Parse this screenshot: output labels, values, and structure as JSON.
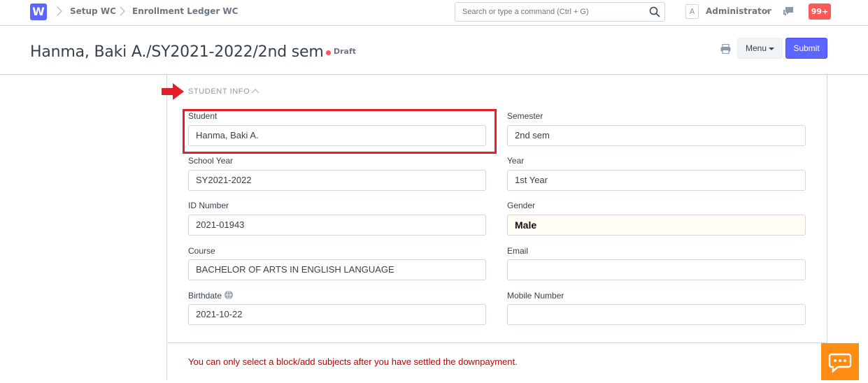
{
  "navbar": {
    "logo": "W",
    "breadcrumbs": [
      "Setup WC",
      "Enrollment Ledger WC"
    ],
    "search_placeholder": "Search or type a command (Ctrl + G)",
    "avatar_letter": "A",
    "user_name": "Administrator",
    "notification_count": "99+"
  },
  "page": {
    "title": "Hanma, Baki A./SY2021-2022/2nd sem",
    "status": "Draft",
    "status_color": "#ff5858",
    "menu_label": "Menu",
    "submit_label": "Submit",
    "accent_color": "#5e64ff"
  },
  "section": {
    "heading": "STUDENT INFO"
  },
  "fields": {
    "student": {
      "label": "Student",
      "value": "Hanma, Baki A."
    },
    "semester": {
      "label": "Semester",
      "value": "2nd sem"
    },
    "school_year": {
      "label": "School Year",
      "value": "SY2021-2022"
    },
    "year": {
      "label": "Year",
      "value": "1st Year"
    },
    "id_number": {
      "label": "ID Number",
      "value": "2021-01943"
    },
    "gender": {
      "label": "Gender",
      "value": "Male"
    },
    "course": {
      "label": "Course",
      "value": "BACHELOR OF ARTS IN ENGLISH LANGUAGE"
    },
    "email": {
      "label": "Email",
      "value": ""
    },
    "birthdate": {
      "label": "Birthdate",
      "value": "2021-10-22"
    },
    "mobile_number": {
      "label": "Mobile Number",
      "value": ""
    }
  },
  "message": "You can only select a block/add subjects after you have settled the downpayment."
}
